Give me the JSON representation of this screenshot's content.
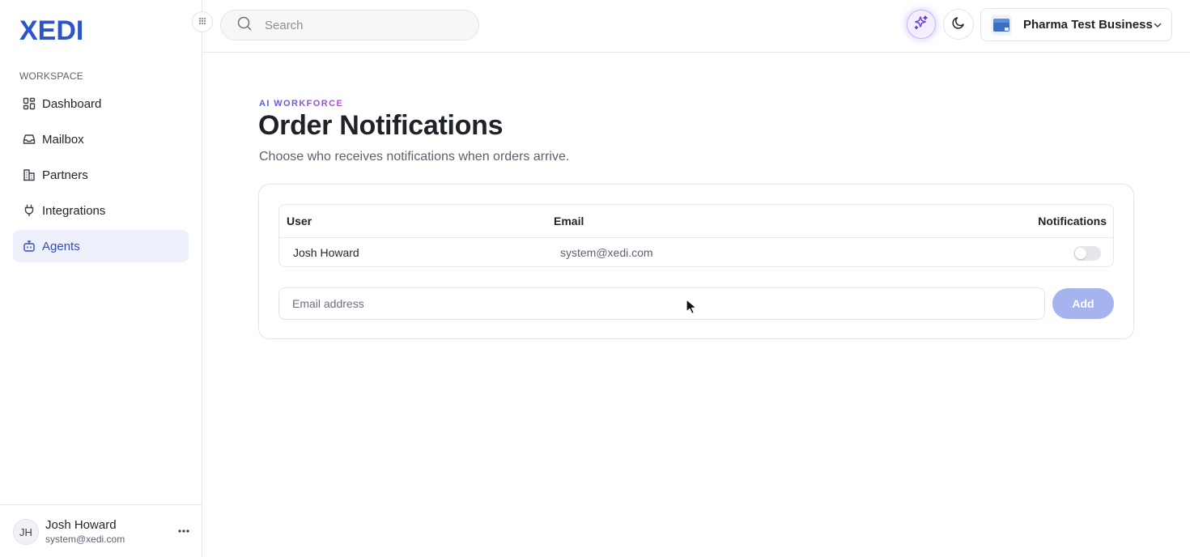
{
  "brand": {
    "logo_text": "XEDI",
    "logo_color": "#2d55c8"
  },
  "sidebar": {
    "section_label": "WORKSPACE",
    "items": [
      {
        "label": "Dashboard",
        "icon": "dashboard-icon",
        "active": false
      },
      {
        "label": "Mailbox",
        "icon": "inbox-icon",
        "active": false
      },
      {
        "label": "Partners",
        "icon": "building-icon",
        "active": false
      },
      {
        "label": "Integrations",
        "icon": "plug-icon",
        "active": false
      },
      {
        "label": "Agents",
        "icon": "bot-icon",
        "active": true
      }
    ],
    "user": {
      "initials": "JH",
      "name": "Josh Howard",
      "email": "system@xedi.com"
    }
  },
  "topbar": {
    "search_placeholder": "Search",
    "business_name": "Pharma Test Business"
  },
  "main": {
    "eyebrow": "AI WORKFORCE",
    "title": "Order Notifications",
    "subtitle": "Choose who receives notifications when orders arrive.",
    "table": {
      "headers": {
        "user": "User",
        "email": "Email",
        "notifications": "Notifications"
      },
      "rows": [
        {
          "user": "Josh Howard",
          "email": "system@xedi.com",
          "notifications_enabled": false
        }
      ]
    },
    "email_input_placeholder": "Email address",
    "add_label": "Add"
  },
  "colors": {
    "accent": "#2f4fb8",
    "active_bg": "#eef1fb",
    "add_button": "#a6b4ee",
    "ai_glow": "#7c4dff"
  }
}
